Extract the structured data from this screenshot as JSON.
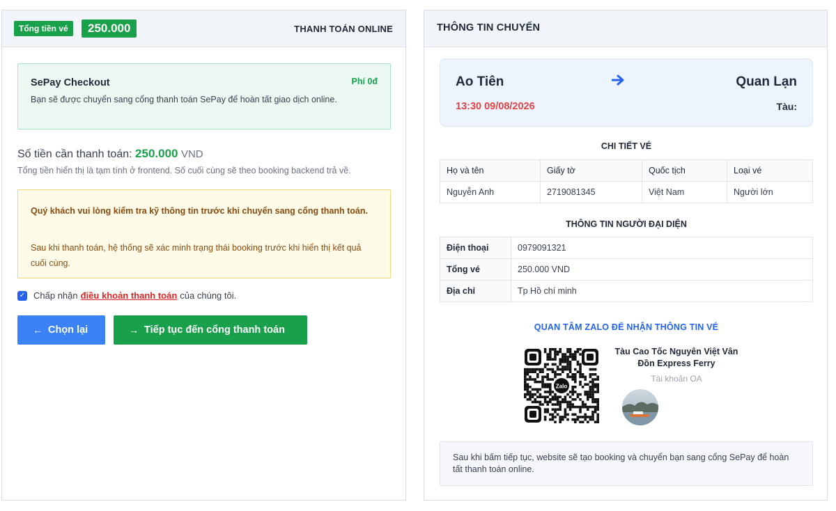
{
  "left": {
    "header": {
      "total_label": "Tổng tiền vé",
      "total_amount": "250.000",
      "payment_mode": "THANH TOÁN ONLINE"
    },
    "sepay": {
      "title": "SePay Checkout",
      "fee": "Phí 0đ",
      "description": "Bạn sẽ được chuyển sang cổng thanh toán SePay để hoàn tất giao dịch online."
    },
    "payment": {
      "label": "Số tiền cần thanh toán:",
      "amount": "250.000",
      "currency": "VND",
      "note": "Tổng tiền hiển thị là tạm tính ở frontend. Số cuối cùng sẽ theo booking backend trả về."
    },
    "warning": {
      "strong": "Quý khách vui lòng kiểm tra kỹ thông tin trước khi chuyển sang cổng thanh toán.",
      "text": "Sau khi thanh toán, hệ thống sẽ xác minh trạng thái booking trước khi hiển thị kết quả cuối cùng."
    },
    "accept": {
      "checked": true,
      "prefix": "Chấp nhận",
      "link": "điều khoản thanh toán",
      "suffix": "của chúng tôi."
    },
    "buttons": {
      "back_icon": "←",
      "back_label": "Chọn lại",
      "next_icon": "→",
      "next_label": "Tiếp tục đến cổng thanh toán"
    }
  },
  "right": {
    "title": "THÔNG TIN CHUYẾN",
    "route": {
      "from": "Ao Tiên",
      "arrow_icon": "arrow-right-icon",
      "to": "Quan Lạn",
      "datetime": "13:30 09/08/2026",
      "ship_label": "Tàu:"
    },
    "ticket": {
      "title": "CHI TIẾT VÉ",
      "headers": [
        "Họ và tên",
        "Giấy tờ",
        "Quốc tịch",
        "Loại vé"
      ],
      "rows": [
        [
          "Nguyễn Anh",
          "2719081345",
          "Việt Nam",
          "Người lớn"
        ]
      ]
    },
    "representative": {
      "title": "THÔNG TIN NGƯỜI ĐẠI DIỆN",
      "rows": [
        {
          "label": "Điện thoại",
          "value": "0979091321"
        },
        {
          "label": "Tổng vé",
          "value": "250.000 VND"
        },
        {
          "label": "Địa chỉ",
          "value": "Tp Hồ chí minh"
        }
      ]
    },
    "zalo": {
      "title": "QUAN TÂM ZALO ĐỂ NHẬN THÔNG TIN VÉ",
      "qr_logo_text": "Zalo",
      "oa_name": "Tàu Cao Tốc Nguyên Việt Vân Đồn Express Ferry",
      "oa_sub": "Tài khoản OA"
    },
    "bottom_note": "Sau khi bấm tiếp tục, website sẽ tạo booking và chuyển bạn sang cổng SePay để hoàn tất thanh toán online."
  },
  "colors": {
    "green": "#19a04a",
    "blue": "#3b82f6",
    "red": "#e04444",
    "warn_text": "#8a4b0f"
  }
}
